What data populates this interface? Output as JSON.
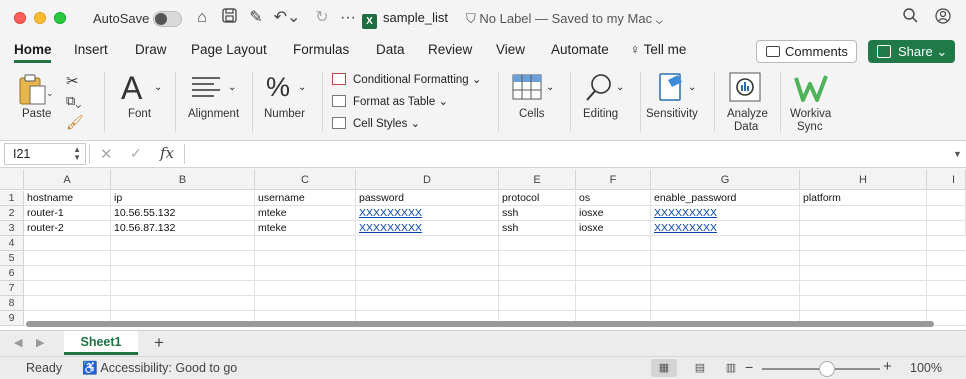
{
  "titlebar": {
    "autosave_label": "AutoSave",
    "document_name": "sample_list",
    "file_badge": "X",
    "label_status": "No Label — Saved to my Mac"
  },
  "ribbon_tabs": [
    "Home",
    "Insert",
    "Draw",
    "Page Layout",
    "Formulas",
    "Data",
    "Review",
    "View",
    "Automate",
    "Tell me"
  ],
  "buttons": {
    "comments": "Comments",
    "share": "Share"
  },
  "ribbon": {
    "paste": "Paste",
    "font": "Font",
    "alignment": "Alignment",
    "number": "Number",
    "conditional_formatting": "Conditional Formatting",
    "format_as_table": "Format as Table",
    "cell_styles": "Cell Styles",
    "cells": "Cells",
    "editing": "Editing",
    "sensitivity": "Sensitivity",
    "analyze_data_line1": "Analyze",
    "analyze_data_line2": "Data",
    "workiva_line1": "Workiva",
    "workiva_line2": "Sync"
  },
  "formula_bar": {
    "name_box": "I21",
    "fx_label": "fx",
    "formula": ""
  },
  "sheet": {
    "columns": [
      "A",
      "B",
      "C",
      "D",
      "E",
      "F",
      "G",
      "H",
      "I"
    ],
    "row_numbers": [
      "1",
      "2",
      "3",
      "4",
      "5",
      "6",
      "7",
      "8",
      "9"
    ],
    "rows": [
      [
        "hostname",
        "ip",
        "username",
        "password",
        "protocol",
        "os",
        "enable_password",
        "platform",
        ""
      ],
      [
        "router-1",
        "10.56.55.132",
        "mteke",
        "XXXXXXXXX",
        "ssh",
        "iosxe",
        "XXXXXXXXX",
        "",
        ""
      ],
      [
        "router-2",
        "10.56.87.132",
        "mteke",
        "XXXXXXXXX",
        "ssh",
        "iosxe",
        "XXXXXXXXX",
        "",
        ""
      ]
    ]
  },
  "sheet_tabs": {
    "active": "Sheet1",
    "add_label": "+"
  },
  "statusbar": {
    "ready": "Ready",
    "accessibility": "Accessibility: Good to go",
    "zoom": "100%",
    "zoom_fraction": 0.5
  },
  "colors": {
    "accent": "#217346",
    "share": "#1f7a47",
    "link": "#0645ad"
  }
}
